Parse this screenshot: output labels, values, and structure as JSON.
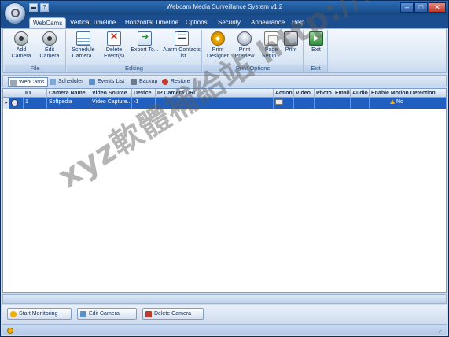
{
  "window": {
    "title": "Webcam Media Surveillance System v1.2"
  },
  "ribbon_tabs": [
    {
      "label": "WebCams",
      "active": true
    },
    {
      "label": "Vertical Timeline"
    },
    {
      "label": "Horizontal Timeline"
    },
    {
      "label": "Options"
    },
    {
      "label": "Security"
    },
    {
      "label": "Appearance"
    },
    {
      "label": "Help"
    }
  ],
  "groups": {
    "file": {
      "label": "File",
      "add_camera": "Add Camera",
      "edit_camera": "Edit Camera"
    },
    "editing": {
      "label": "Editing",
      "schedule_camera": "Schedule Camera..",
      "delete_events": "Delete Event(s)",
      "export_to": "Export To...",
      "alarm_contacts": "Alarm Contacts List"
    },
    "print": {
      "label": "Print Options",
      "print_designer": "Print Designer",
      "print_preview": "Print Preview",
      "page_setup": "Page Setup...",
      "print": "Print"
    },
    "exit": {
      "label": "Exit",
      "exit": "Exit"
    }
  },
  "sub_tabs": [
    {
      "label": "WebCams",
      "active": true
    },
    {
      "label": "Scheduler"
    },
    {
      "label": "Events List"
    },
    {
      "label": "Backup"
    },
    {
      "label": "Restore"
    }
  ],
  "grid": {
    "columns": [
      "ID",
      "Camera Name",
      "Video Source",
      "Device",
      "IP Camera URL",
      "Action",
      "Video",
      "Photo",
      "Email",
      "Audio",
      "Enable Motion Detection"
    ],
    "rows": [
      {
        "id": "1",
        "camera_name": "Softpedia",
        "video_source": "Video Capture...",
        "device": "-1",
        "ip_camera_url": "",
        "motion_detection": "No"
      }
    ]
  },
  "bottom_buttons": {
    "start_monitoring": "Start Monitoring",
    "edit_camera": "Edit Camera",
    "delete_camera": "Delete Camera"
  },
  "watermark": "xyz軟體補給站 http://31.to",
  "colors": {
    "selected_row": "#1f5fc0",
    "ribbon_bg": "#dbe7f5",
    "title_bar": "#15477f"
  }
}
